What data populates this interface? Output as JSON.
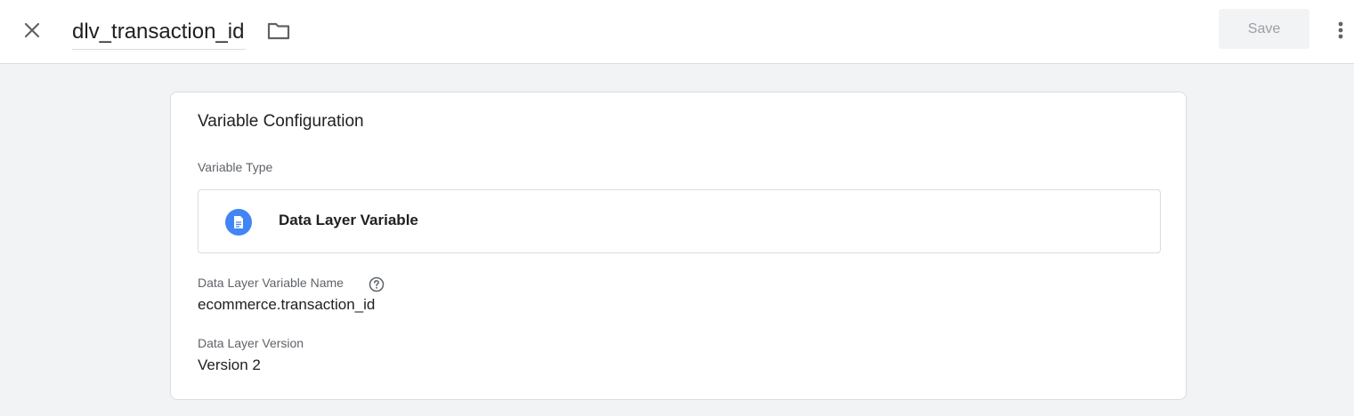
{
  "header": {
    "title": "dlv_transaction_id",
    "close_icon": "close-icon",
    "folder_icon": "folder-icon",
    "save_label": "Save",
    "more_icon": "more-vert-icon"
  },
  "card": {
    "title": "Variable Configuration",
    "variable_type": {
      "label": "Variable Type",
      "value": "Data Layer Variable",
      "icon": "document-icon",
      "icon_color": "#4285f4"
    },
    "dlv_name": {
      "label": "Data Layer Variable Name",
      "help_icon": "help-icon",
      "value": "ecommerce.transaction_id"
    },
    "dl_version": {
      "label": "Data Layer Version",
      "value": "Version 2"
    }
  },
  "colors": {
    "background": "#f1f3f4",
    "accent": "#4285f4",
    "save_disabled_text": "#9aa0a6"
  }
}
